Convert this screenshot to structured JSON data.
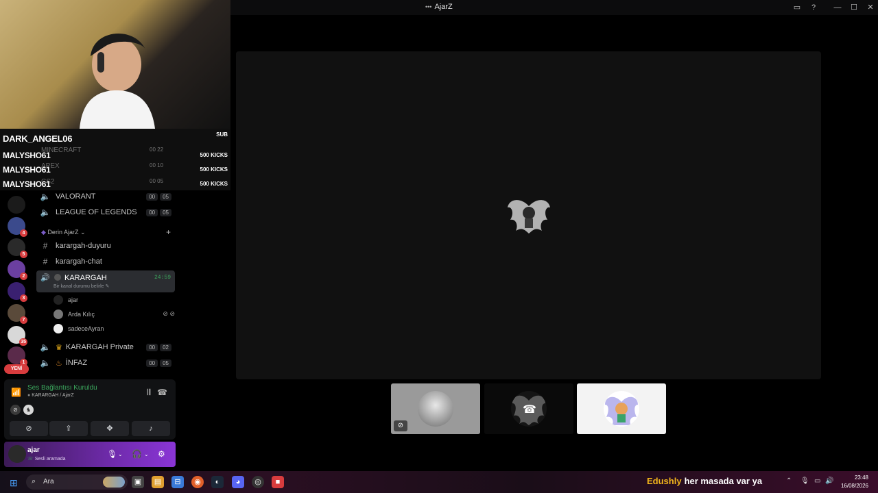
{
  "window": {
    "title": "AjarZ"
  },
  "overlay": {
    "follower_name": "DARK_ANGEL06",
    "sub_tag": "SUB",
    "kicks": [
      {
        "name": "MALYSHO61",
        "amount": "500 KICKS"
      },
      {
        "name": "MALYSHO61",
        "amount": "500 KICKS"
      },
      {
        "name": "MALYSHO61",
        "amount": "500 KICKS"
      }
    ]
  },
  "channels_hidden": [
    {
      "name": "MINECRAFT",
      "a": "00",
      "b": "22"
    },
    {
      "name": "APEX",
      "a": "00",
      "b": "10"
    },
    {
      "name": "CS2",
      "a": "00",
      "b": "05"
    }
  ],
  "channels": [
    {
      "name": "VALORANT",
      "a": "00",
      "b": "05"
    },
    {
      "name": "LEAGUE OF LEGENDS",
      "a": "00",
      "b": "05"
    }
  ],
  "category": {
    "name": "Derin AjarZ"
  },
  "text_channels": [
    "karargah-duyuru",
    "karargah-chat"
  ],
  "active_channel": {
    "name": "KARARGAH",
    "time": "24:59",
    "status": "Bir kanal durumu belirle"
  },
  "voice_users": [
    "ajar",
    "Arda Kılıç",
    "sadeceAyran"
  ],
  "channels_after": [
    {
      "name": "KARARGAH Private",
      "a": "00",
      "b": "02"
    },
    {
      "name": "İNFAZ",
      "a": "00",
      "b": "05"
    }
  ],
  "servers": {
    "badges": [
      "4",
      "5",
      "2",
      "3",
      "7",
      "35",
      "1"
    ],
    "new_label": "YENİ"
  },
  "voice_panel": {
    "status": "Ses Bağlantısı Kuruldu",
    "location": "KARARGAH / AjarZ"
  },
  "user_panel": {
    "name": "ajar",
    "status": "Sesli aramada"
  },
  "taskbar": {
    "search_placeholder": "Ara",
    "ticker_user": "Edushly",
    "ticker_text": "her masada var ya",
    "time": "23:48",
    "date": "16/08/2026"
  }
}
